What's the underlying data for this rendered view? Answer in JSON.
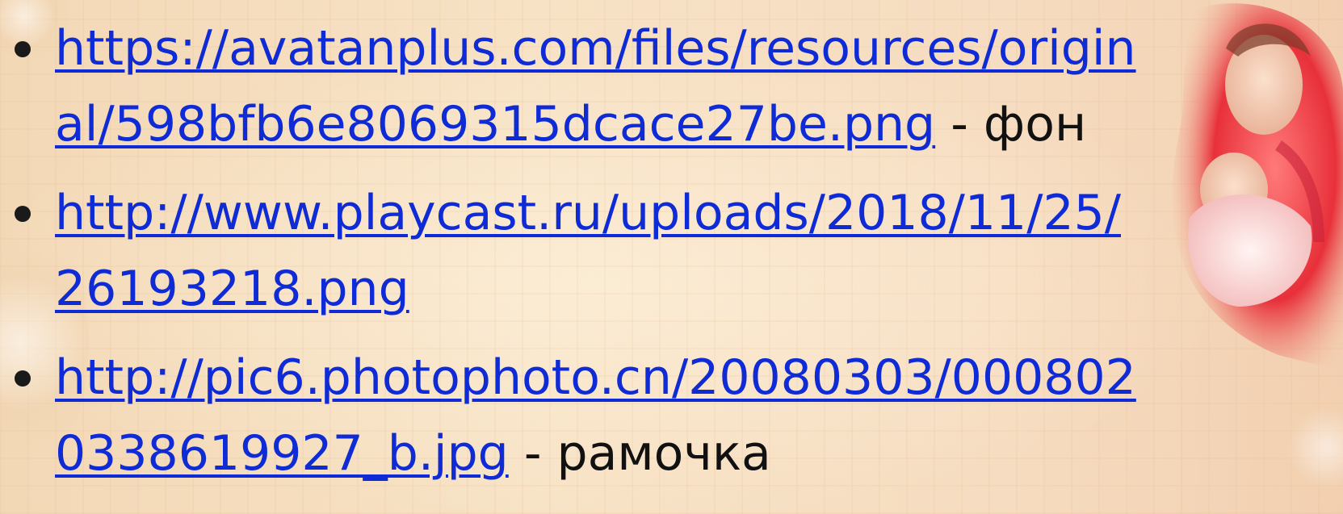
{
  "items": [
    {
      "url_line1": "https://avatanplus.com/files/resources/origin",
      "url_line2": "al/598bfb6e8069315dcace27be.png",
      "suffix": " - фон"
    },
    {
      "url_line1": "http://www.playcast.ru/uploads/2018/11/25/",
      "url_line2": "26193218.png",
      "suffix": ""
    },
    {
      "url_line1": "http://pic6.photophoto.cn/20080303/000802",
      "url_line2": "0338619927_b.jpg",
      "suffix": " - рамочка"
    }
  ],
  "colors": {
    "link": "#0f2bd6",
    "text": "#000000",
    "background": "#f5dcbc"
  }
}
